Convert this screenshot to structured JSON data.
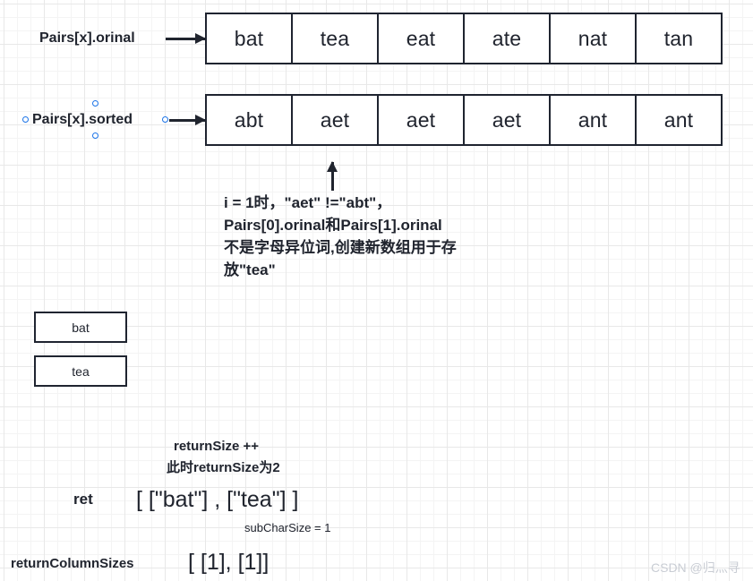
{
  "diagram": {
    "arrays": [
      {
        "label": "Pairs[x].orinal",
        "cells": [
          "bat",
          "tea",
          "eat",
          "ate",
          "nat",
          "tan"
        ]
      },
      {
        "label": "Pairs[x].sorted",
        "cells": [
          "abt",
          "aet",
          "aet",
          "aet",
          "ant",
          "ant"
        ]
      }
    ],
    "annotation": "i = 1时，\"aet\" !=\"abt\"，Pairs[0].orinal和Pairs[1].orinal不是字母异位词,创建新数组用于存放\"tea\"",
    "result_boxes": [
      "bat",
      "tea"
    ],
    "bottom": {
      "return_size_line1": "returnSize ++",
      "return_size_line2": "此时returnSize为2",
      "ret_label": "ret",
      "ret_value": "[  [\"bat\"] ,  [\"tea\"]  ]",
      "sub_char_size": "subCharSize = 1",
      "return_column_sizes_label": "returnColumnSizes",
      "return_column_sizes_value": "[ [1], [1]]"
    },
    "watermark": "CSDN @归灬寻",
    "colors": {
      "stroke": "#1f2430",
      "selection": "#1a73e8",
      "grid_major": "#e8e8e8",
      "grid_minor": "#f4f4f4",
      "watermark": "#c9cdd4"
    }
  }
}
